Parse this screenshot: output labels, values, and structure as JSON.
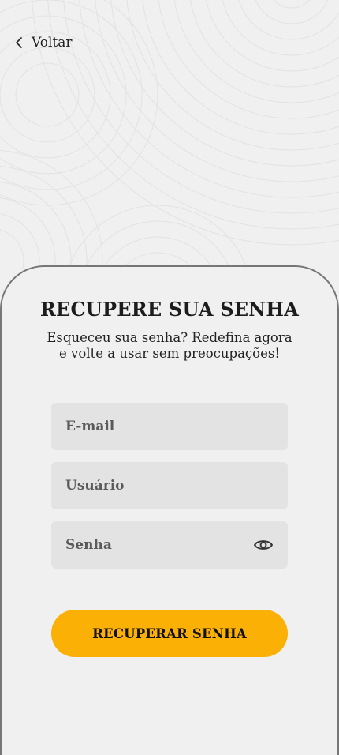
{
  "header": {
    "back_label": "Voltar"
  },
  "form": {
    "title": "RECUPERE SUA SENHA",
    "subtitle": "Esqueceu sua senha? Redefina agora e volte a usar sem preocupações!",
    "email_placeholder": "E-mail",
    "email_value": "",
    "username_placeholder": "Usuário",
    "username_value": "",
    "password_placeholder": "Senha",
    "password_value": "",
    "submit_label": "RECUPERAR SENHA"
  },
  "icons": {
    "back": "chevron-left-icon",
    "password_toggle": "eye-icon"
  },
  "colors": {
    "background": "#f0f0f0",
    "field_background": "#e3e3e3",
    "accent": "#fab005",
    "sheet_border": "#777777"
  }
}
